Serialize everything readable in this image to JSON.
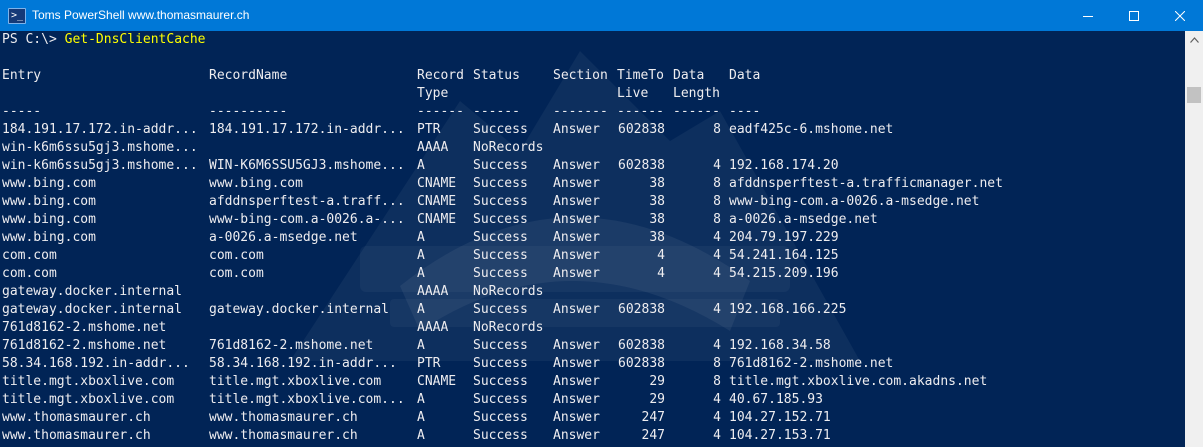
{
  "window": {
    "title": "Toms PowerShell www.thomasmaurer.ch",
    "icon_glyph": ">_"
  },
  "icons": {
    "app": "powershell-icon",
    "minimize": "minimize-icon",
    "maximize": "maximize-icon",
    "close": "close-icon",
    "scroll_up": "chevron-up-icon",
    "watermark": "mountain-logo-icon"
  },
  "colors": {
    "background": "#012456",
    "titlebar": "#0078d7",
    "text": "#eeedf0",
    "command": "#ffff00"
  },
  "console": {
    "prompt": "PS C:\\> ",
    "command": "Get-DnsClientCache",
    "header1": {
      "entry": "Entry",
      "record_name": "RecordName",
      "record": "Record",
      "status": "Status",
      "section": "Section",
      "time_to": "TimeTo",
      "data_top": "Data",
      "data": "Data"
    },
    "header2": {
      "type": "Type",
      "live": "Live",
      "length": "Length"
    },
    "separator": {
      "entry": "-----",
      "record_name": "----------",
      "record_type": "------",
      "status": "------",
      "section": "-------",
      "ttl": "------",
      "data_length": "------",
      "data": "----"
    },
    "rows": [
      {
        "entry": "184.191.17.172.in-addr...",
        "record_name": "184.191.17.172.in-addr...",
        "type": "PTR",
        "status": "Success",
        "section": "Answer",
        "ttl": "602838",
        "data_length": "8",
        "data": "eadf425c-6.mshome.net"
      },
      {
        "entry": "win-k6m6ssu5gj3.mshome...",
        "record_name": "",
        "type": "AAAA",
        "status": "NoRecords",
        "section": "",
        "ttl": "",
        "data_length": "",
        "data": ""
      },
      {
        "entry": "win-k6m6ssu5gj3.mshome...",
        "record_name": "WIN-K6M6SSU5GJ3.mshome...",
        "type": "A",
        "status": "Success",
        "section": "Answer",
        "ttl": "602838",
        "data_length": "4",
        "data": "192.168.174.20"
      },
      {
        "entry": "www.bing.com",
        "record_name": "www.bing.com",
        "type": "CNAME",
        "status": "Success",
        "section": "Answer",
        "ttl": "38",
        "data_length": "8",
        "data": "afddnsperftest-a.trafficmanager.net"
      },
      {
        "entry": "www.bing.com",
        "record_name": "afddnsperftest-a.traff...",
        "type": "CNAME",
        "status": "Success",
        "section": "Answer",
        "ttl": "38",
        "data_length": "8",
        "data": "www-bing-com.a-0026.a-msedge.net"
      },
      {
        "entry": "www.bing.com",
        "record_name": "www-bing-com.a-0026.a-...",
        "type": "CNAME",
        "status": "Success",
        "section": "Answer",
        "ttl": "38",
        "data_length": "8",
        "data": "a-0026.a-msedge.net"
      },
      {
        "entry": "www.bing.com",
        "record_name": "a-0026.a-msedge.net",
        "type": "A",
        "status": "Success",
        "section": "Answer",
        "ttl": "38",
        "data_length": "4",
        "data": "204.79.197.229"
      },
      {
        "entry": "com.com",
        "record_name": "com.com",
        "type": "A",
        "status": "Success",
        "section": "Answer",
        "ttl": "4",
        "data_length": "4",
        "data": "54.241.164.125"
      },
      {
        "entry": "com.com",
        "record_name": "com.com",
        "type": "A",
        "status": "Success",
        "section": "Answer",
        "ttl": "4",
        "data_length": "4",
        "data": "54.215.209.196"
      },
      {
        "entry": "gateway.docker.internal",
        "record_name": "",
        "type": "AAAA",
        "status": "NoRecords",
        "section": "",
        "ttl": "",
        "data_length": "",
        "data": ""
      },
      {
        "entry": "gateway.docker.internal",
        "record_name": "gateway.docker.internal",
        "type": "A",
        "status": "Success",
        "section": "Answer",
        "ttl": "602838",
        "data_length": "4",
        "data": "192.168.166.225"
      },
      {
        "entry": "761d8162-2.mshome.net",
        "record_name": "",
        "type": "AAAA",
        "status": "NoRecords",
        "section": "",
        "ttl": "",
        "data_length": "",
        "data": ""
      },
      {
        "entry": "761d8162-2.mshome.net",
        "record_name": "761d8162-2.mshome.net",
        "type": "A",
        "status": "Success",
        "section": "Answer",
        "ttl": "602838",
        "data_length": "4",
        "data": "192.168.34.58"
      },
      {
        "entry": "58.34.168.192.in-addr...",
        "record_name": "58.34.168.192.in-addr...",
        "type": "PTR",
        "status": "Success",
        "section": "Answer",
        "ttl": "602838",
        "data_length": "8",
        "data": "761d8162-2.mshome.net"
      },
      {
        "entry": "title.mgt.xboxlive.com",
        "record_name": "title.mgt.xboxlive.com",
        "type": "CNAME",
        "status": "Success",
        "section": "Answer",
        "ttl": "29",
        "data_length": "8",
        "data": "title.mgt.xboxlive.com.akadns.net"
      },
      {
        "entry": "title.mgt.xboxlive.com",
        "record_name": "title.mgt.xboxlive.com...",
        "type": "A",
        "status": "Success",
        "section": "Answer",
        "ttl": "29",
        "data_length": "4",
        "data": "40.67.185.93"
      },
      {
        "entry": "www.thomasmaurer.ch",
        "record_name": "www.thomasmaurer.ch",
        "type": "A",
        "status": "Success",
        "section": "Answer",
        "ttl": "247",
        "data_length": "4",
        "data": "104.27.152.71"
      },
      {
        "entry": "www.thomasmaurer.ch",
        "record_name": "www.thomasmaurer.ch",
        "type": "A",
        "status": "Success",
        "section": "Answer",
        "ttl": "247",
        "data_length": "4",
        "data": "104.27.153.71"
      }
    ]
  }
}
